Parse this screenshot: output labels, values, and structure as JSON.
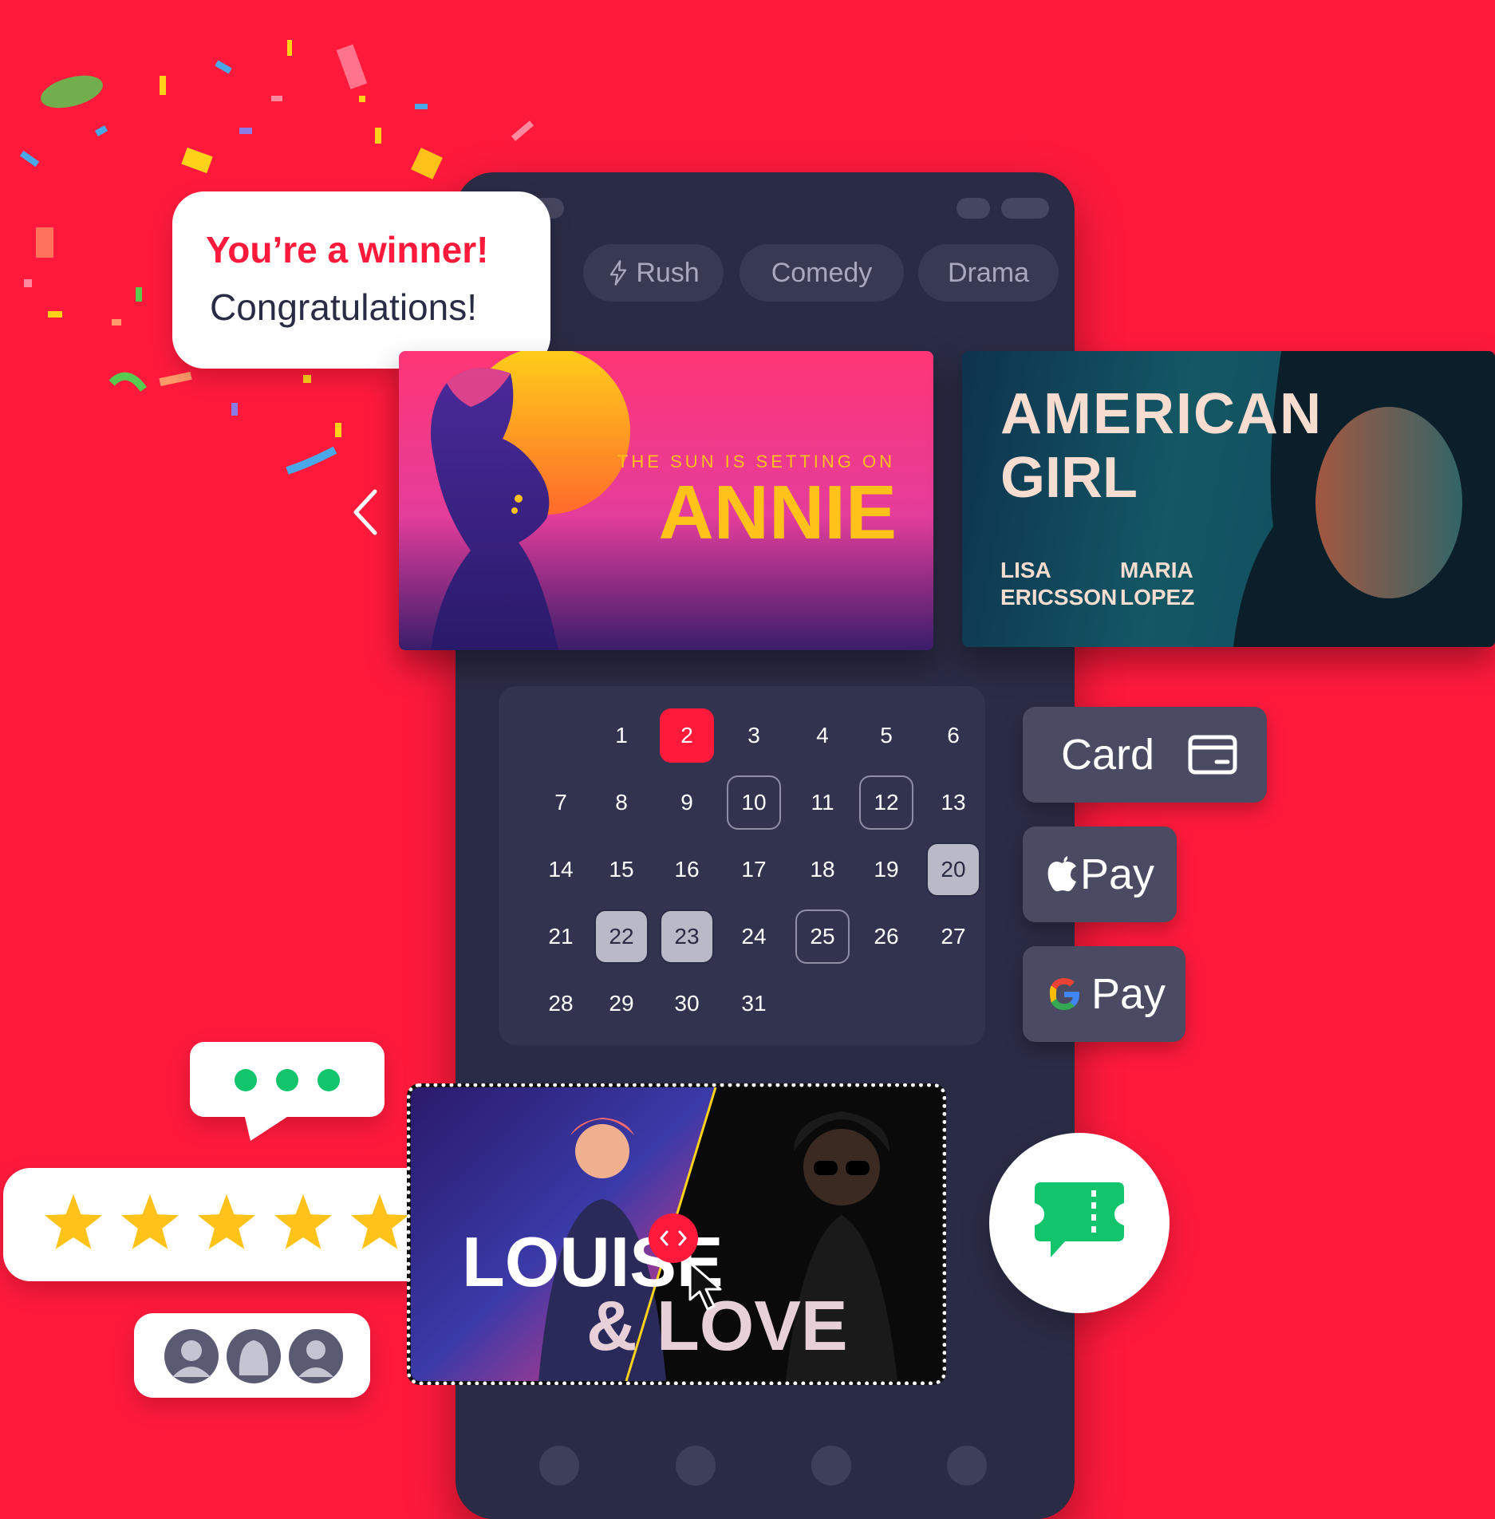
{
  "winner": {
    "title": "You’re a winner!",
    "subtitle": "Congratulations!"
  },
  "tabs": [
    {
      "label": "Rush",
      "icon": "lightning-icon"
    },
    {
      "label": "Comedy"
    },
    {
      "label": "Drama"
    }
  ],
  "posters": {
    "annie": {
      "tagline": "THE SUN IS SETTING ON",
      "title": "ANNIE"
    },
    "american_girl": {
      "title_line1": "AMERICAN",
      "title_line2": "GIRL",
      "cast1_first": "LISA",
      "cast1_last": "ERICSSON",
      "cast2_first": "MARIA",
      "cast2_last": "LOPEZ"
    },
    "louise": {
      "line1": "LOUISE",
      "line2": "& LOVE"
    }
  },
  "calendar": {
    "days": [
      {
        "n": "1",
        "state": "normal"
      },
      {
        "n": "2",
        "state": "selected"
      },
      {
        "n": "3",
        "state": "normal"
      },
      {
        "n": "4",
        "state": "normal"
      },
      {
        "n": "5",
        "state": "normal"
      },
      {
        "n": "6",
        "state": "normal"
      },
      {
        "n": "7",
        "state": "normal"
      },
      {
        "n": "8",
        "state": "normal"
      },
      {
        "n": "9",
        "state": "normal"
      },
      {
        "n": "10",
        "state": "outlined"
      },
      {
        "n": "11",
        "state": "normal"
      },
      {
        "n": "12",
        "state": "outlined"
      },
      {
        "n": "13",
        "state": "normal"
      },
      {
        "n": "14",
        "state": "normal"
      },
      {
        "n": "15",
        "state": "normal"
      },
      {
        "n": "16",
        "state": "normal"
      },
      {
        "n": "17",
        "state": "normal"
      },
      {
        "n": "18",
        "state": "normal"
      },
      {
        "n": "19",
        "state": "normal"
      },
      {
        "n": "20",
        "state": "grey"
      },
      {
        "n": "21",
        "state": "normal"
      },
      {
        "n": "22",
        "state": "grey"
      },
      {
        "n": "23",
        "state": "grey"
      },
      {
        "n": "24",
        "state": "normal"
      },
      {
        "n": "25",
        "state": "outlined"
      },
      {
        "n": "26",
        "state": "normal"
      },
      {
        "n": "27",
        "state": "normal"
      },
      {
        "n": "28",
        "state": "normal"
      },
      {
        "n": "29",
        "state": "normal"
      },
      {
        "n": "30",
        "state": "normal"
      },
      {
        "n": "31",
        "state": "normal"
      }
    ]
  },
  "payments": {
    "card": {
      "label": "Card",
      "icon": "credit-card-icon"
    },
    "apple_pay": {
      "label": "Pay",
      "icon": "apple-icon"
    },
    "google_pay": {
      "label": "Pay",
      "icon": "google-g-icon"
    }
  },
  "rating": {
    "stars": 5,
    "max": 5
  },
  "colors": {
    "background": "#ff1a3c",
    "phone": "#2a2b45",
    "accent": "#ff1a3c",
    "star": "#ffc21a",
    "chat_green": "#12c46b"
  }
}
